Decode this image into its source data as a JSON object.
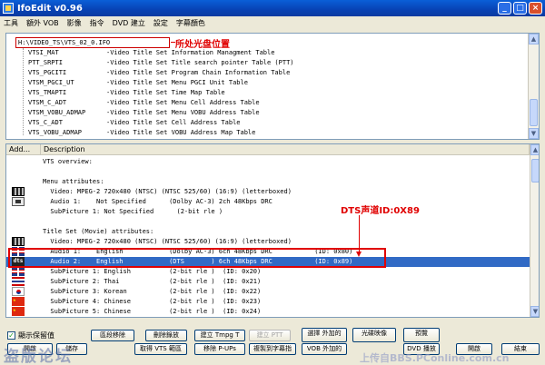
{
  "window": {
    "title": "IfoEdit v0.96"
  },
  "menu": [
    "工具",
    "額外 VOB",
    "影像",
    "指令",
    "DVD 建立",
    "設定",
    "字幕顏色"
  ],
  "top": {
    "path": "H:\\VIDEO_TS\\VTS_02_0.IFO",
    "annotation": "所处光盘位置",
    "rows": [
      {
        "name": "VTSI_MAT",
        "desc": "-Video Title Set Information Managment Table"
      },
      {
        "name": "PTT_SRPTI",
        "desc": "-Video Title Set Title search pointer Table (PTT)"
      },
      {
        "name": "VTS_PGCITI",
        "desc": "-Video Title Set Program Chain Information Table"
      },
      {
        "name": "VTSM_PGCI_UT",
        "desc": "-Video Title Set Menu PGCI Unit Table"
      },
      {
        "name": "VTS_TMAPTI",
        "desc": "-Video Title Set Time Map Table"
      },
      {
        "name": "VTSM_C_ADT",
        "desc": "-Video Title Set Menu Cell Address Table"
      },
      {
        "name": "VTSM_VOBU_ADMAP",
        "desc": "-Video Title Set Menu VOBU Address Table"
      },
      {
        "name": "VTS_C_ADT",
        "desc": "-Video Title Set Cell Address Table"
      },
      {
        "name": "VTS_VOBU_ADMAP",
        "desc": "-Video Title Set VOBU Address Map Table"
      }
    ]
  },
  "bottom": {
    "headers": [
      "Add...",
      "Description"
    ],
    "annotation": "DTS声道ID:0X89",
    "rows": [
      {
        "icon": "",
        "text": "VTS overview:"
      },
      {
        "icon": "",
        "text": ""
      },
      {
        "icon": "",
        "text": "Menu attributes:"
      },
      {
        "icon": "film",
        "text": "  Video: MPEG-2 720x480 (NTSC) (NTSC 525/60) (16:9) (letterboxed)"
      },
      {
        "icon": "audio",
        "text": "  Audio 1:    Not Specified      (Dolby AC-3) 2ch 48Kbps DRC"
      },
      {
        "icon": "",
        "text": "  SubPicture 1: Not Specified      (2-bit rle )"
      },
      {
        "icon": "",
        "text": ""
      },
      {
        "icon": "",
        "text": "Title Set (Movie) attributes:"
      },
      {
        "icon": "film",
        "text": "  Video: MPEG-2 720x480 (NTSC) (NTSC 525/60) (16:9) (letterboxed)"
      },
      {
        "icon": "uk",
        "text": "  Audio 1:    English            (Dolby AC-3) 6ch 48Kbps DRC           (ID: 0x80)"
      },
      {
        "icon": "dts",
        "text": "  Audio 2:    English            (DTS       ) 6ch 48Kbps DRC           (ID: 0x89)",
        "selected": true
      },
      {
        "icon": "uk",
        "text": "  SubPicture 1: English          (2-bit rle )  (ID: 0x20)"
      },
      {
        "icon": "th",
        "text": "  SubPicture 2: Thai             (2-bit rle )  (ID: 0x21)"
      },
      {
        "icon": "kr",
        "text": "  SubPicture 3: Korean           (2-bit rle )  (ID: 0x22)"
      },
      {
        "icon": "cn",
        "text": "  SubPicture 4: Chinese          (2-bit rle )  (ID: 0x23)"
      },
      {
        "icon": "cn",
        "text": "  SubPicture 5: Chinese          (2-bit rle )  (ID: 0x24)"
      }
    ]
  },
  "controls": {
    "checkbox_label": "顯示保留值",
    "btn_remove": "區段移除",
    "btn_delete": "刪除錄放",
    "btn_build_tmpg": "建立 Tmpg T",
    "btn_build_ptt": "建立 PTT",
    "btn_select_vob": "選擇 外加的",
    "btn_blob_img": "光碟映像",
    "btn_preview": "預覽",
    "btn_start": "開啟",
    "btn_split": "儲存",
    "btn_get_vts": "取得 VTS 範區",
    "btn_remove_pups": "移除 P-UPs",
    "btn_copy_sub": "複製到字幕指",
    "btn_vob_out": "VOB 外加的",
    "btn_dvd_play": "DVD 播放",
    "btn_open": "開啟",
    "btn_exit": "結束"
  },
  "watermarks": {
    "left": "盗版论坛",
    "right": "上传自BBS.PConline.com.cn"
  }
}
